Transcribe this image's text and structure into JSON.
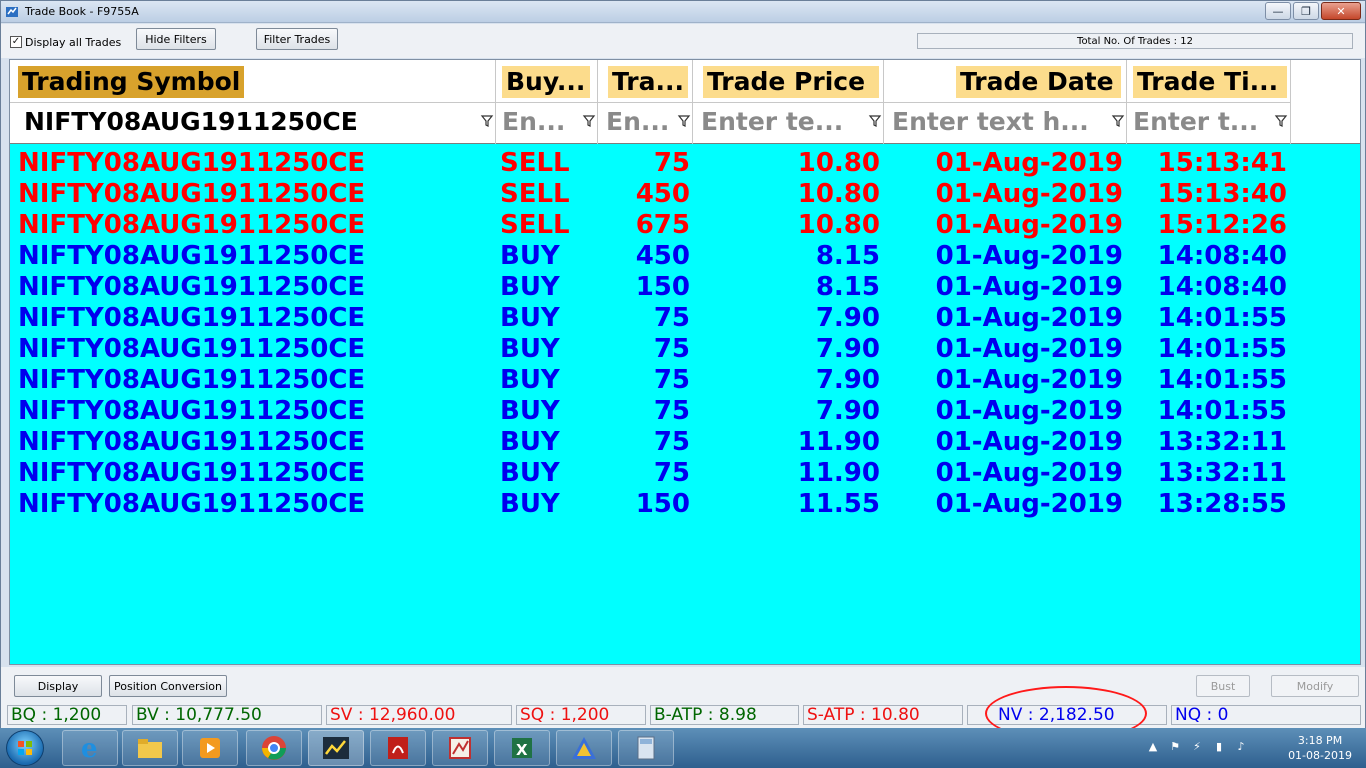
{
  "window": {
    "title": "Trade Book - F9755A"
  },
  "toolbar": {
    "display_all_label": "Display all Trades",
    "hide_filters_label": "Hide Filters",
    "filter_trades_label": "Filter Trades",
    "total_trades": "Total No. Of Trades : 12"
  },
  "grid": {
    "headers": [
      "Trading Symbol",
      "Buy...",
      "Tra...",
      "Trade Price",
      "Trade Date",
      "Trade Ti..."
    ],
    "filters": [
      "NIFTY08AUG1911250CE",
      "En...",
      "En...",
      "Enter te...",
      "Enter text h...",
      "Enter t..."
    ],
    "rows": [
      {
        "symbol": "NIFTY08AUG1911250CE",
        "side": "SELL",
        "qty": "75",
        "price": "10.80",
        "date": "01-Aug-2019",
        "time": "15:13:41"
      },
      {
        "symbol": "NIFTY08AUG1911250CE",
        "side": "SELL",
        "qty": "450",
        "price": "10.80",
        "date": "01-Aug-2019",
        "time": "15:13:40"
      },
      {
        "symbol": "NIFTY08AUG1911250CE",
        "side": "SELL",
        "qty": "675",
        "price": "10.80",
        "date": "01-Aug-2019",
        "time": "15:12:26"
      },
      {
        "symbol": "NIFTY08AUG1911250CE",
        "side": "BUY",
        "qty": "450",
        "price": "8.15",
        "date": "01-Aug-2019",
        "time": "14:08:40"
      },
      {
        "symbol": "NIFTY08AUG1911250CE",
        "side": "BUY",
        "qty": "150",
        "price": "8.15",
        "date": "01-Aug-2019",
        "time": "14:08:40"
      },
      {
        "symbol": "NIFTY08AUG1911250CE",
        "side": "BUY",
        "qty": "75",
        "price": "7.90",
        "date": "01-Aug-2019",
        "time": "14:01:55"
      },
      {
        "symbol": "NIFTY08AUG1911250CE",
        "side": "BUY",
        "qty": "75",
        "price": "7.90",
        "date": "01-Aug-2019",
        "time": "14:01:55"
      },
      {
        "symbol": "NIFTY08AUG1911250CE",
        "side": "BUY",
        "qty": "75",
        "price": "7.90",
        "date": "01-Aug-2019",
        "time": "14:01:55"
      },
      {
        "symbol": "NIFTY08AUG1911250CE",
        "side": "BUY",
        "qty": "75",
        "price": "7.90",
        "date": "01-Aug-2019",
        "time": "14:01:55"
      },
      {
        "symbol": "NIFTY08AUG1911250CE",
        "side": "BUY",
        "qty": "75",
        "price": "11.90",
        "date": "01-Aug-2019",
        "time": "13:32:11"
      },
      {
        "symbol": "NIFTY08AUG1911250CE",
        "side": "BUY",
        "qty": "75",
        "price": "11.90",
        "date": "01-Aug-2019",
        "time": "13:32:11"
      },
      {
        "symbol": "NIFTY08AUG1911250CE",
        "side": "BUY",
        "qty": "150",
        "price": "11.55",
        "date": "01-Aug-2019",
        "time": "13:28:55"
      }
    ]
  },
  "actions": {
    "display_label": "Display",
    "position_conversion_label": "Position Conversion",
    "bust_label": "Bust",
    "modify_label": "Modify"
  },
  "stats": {
    "bq": "BQ : 1,200",
    "bv": "BV : 10,777.50",
    "sv": "SV : 12,960.00",
    "sq": "SQ : 1,200",
    "batp": "B-ATP : 8.98",
    "satp": "S-ATP : 10.80",
    "nv": "NV : 2,182.50",
    "nq": "NQ : 0"
  },
  "taskbar": {
    "time": "3:18 PM",
    "date": "01-08-2019"
  },
  "colors": {
    "sell": "#ff0000",
    "buy": "#0000ee",
    "grid_bg": "#00ffff",
    "header_label": "#fcdc8c",
    "annotation": "#ff1a1a"
  }
}
